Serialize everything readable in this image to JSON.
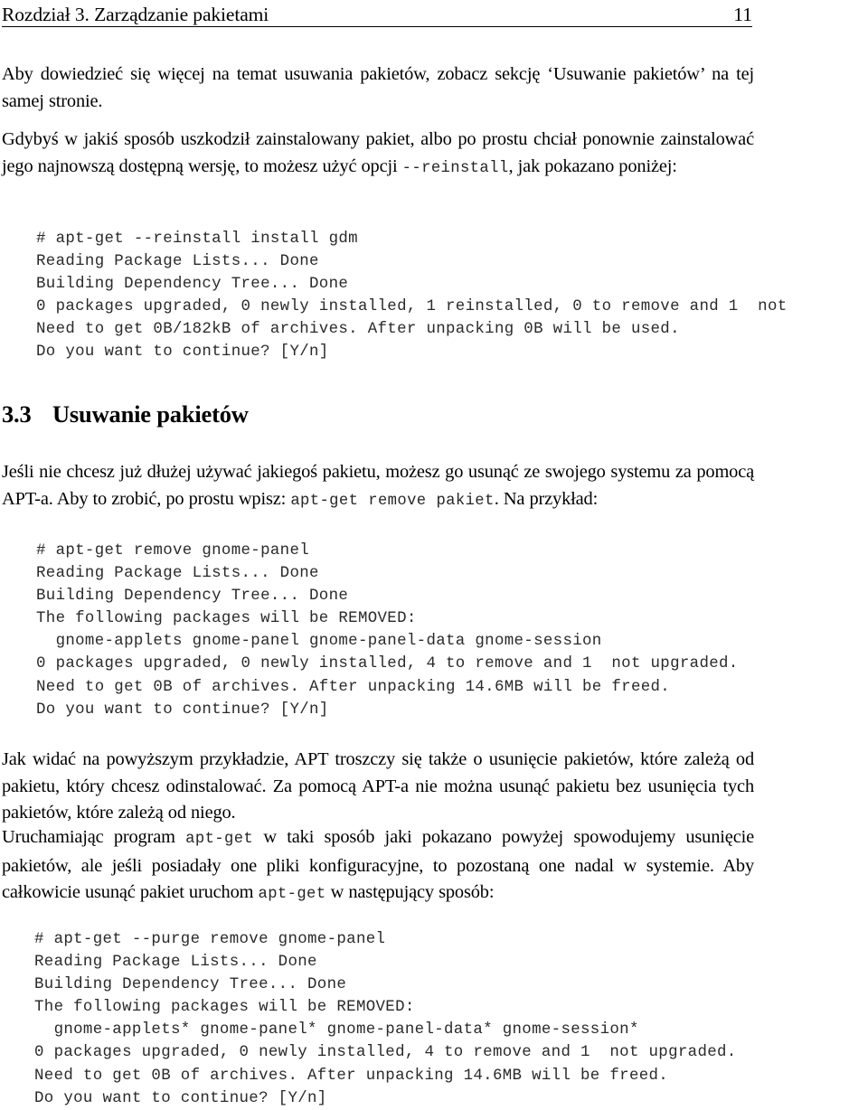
{
  "header": {
    "title": "Rozdział 3. Zarządzanie pakietami",
    "page_number": "11"
  },
  "paragraphs": {
    "intro": "Aby dowiedzieć się więcej na temat usuwania pakietów, zobacz sekcję ‘Usuwanie pakietów’ na tej samej stronie.",
    "broken_pre": "Gdybyś w jakiś sposób uszkodził zainstalowany pakiet, albo po prostu chciał ponownie zainstalować jego najnowszą dostępną wersję, to możesz użyć opcji ",
    "broken_code": "--reinstall",
    "broken_post": ", jak pokazano poniżej:",
    "removal_lead_pre": "Jeśli nie chcesz już dłużej używać jakiegoś pakietu, możesz go usunąć ze swojego systemu za pomocą APT-a. Aby to zrobić, po prostu wpisz: ",
    "removal_lead_code": "apt-get remove pakiet",
    "removal_lead_post": ". Na przykład:",
    "deps": "Jak widać na powyższym przykładzie, APT troszczy się także o usunięcie pakietów, które zależą od pakietu, który chcesz odinstalować.  Za pomocą APT-a nie można usunąć pakietu bez usunięcia tych pakietów, które zależą od niego.",
    "purge_lead_p1": "Uruchamiając program ",
    "purge_lead_c1": "apt-get",
    "purge_lead_p2": " w taki sposób jaki pokazano powyżej spowodujemy usunięcie pakietów, ale jeśli posiadały one pliki konfiguracyjne, to pozostaną one nadal w systemie. Aby całkowicie usunąć pakiet uruchom ",
    "purge_lead_c2": "apt-get",
    "purge_lead_p3": " w następujący sposób:"
  },
  "section": {
    "number": "3.3",
    "title": "Usuwanie pakietów"
  },
  "code_blocks": {
    "reinstall": "# apt-get --reinstall install gdm\nReading Package Lists... Done\nBuilding Dependency Tree... Done\n0 packages upgraded, 0 newly installed, 1 reinstalled, 0 to remove and 1  not\nNeed to get 0B/182kB of archives. After unpacking 0B will be used.\nDo you want to continue? [Y/n]",
    "remove": "# apt-get remove gnome-panel\nReading Package Lists... Done\nBuilding Dependency Tree... Done\nThe following packages will be REMOVED:\n  gnome-applets gnome-panel gnome-panel-data gnome-session\n0 packages upgraded, 0 newly installed, 4 to remove and 1  not upgraded.\nNeed to get 0B of archives. After unpacking 14.6MB will be freed.\nDo you want to continue? [Y/n]",
    "purge": "# apt-get --purge remove gnome-panel\nReading Package Lists... Done\nBuilding Dependency Tree... Done\nThe following packages will be REMOVED:\n  gnome-applets* gnome-panel* gnome-panel-data* gnome-session*\n0 packages upgraded, 0 newly installed, 4 to remove and 1  not upgraded.\nNeed to get 0B of archives. After unpacking 14.6MB will be freed.\nDo you want to continue? [Y/n]"
  },
  "colors": {
    "text": "#000000",
    "code": "#2a2a2a",
    "rule": "#000000",
    "background": "#ffffff"
  }
}
